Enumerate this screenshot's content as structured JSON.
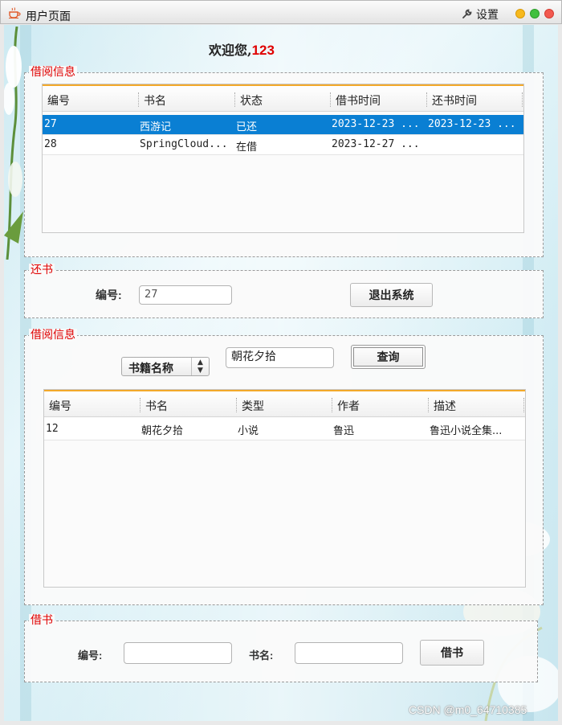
{
  "window": {
    "title": "用户页面",
    "settings_label": "设置"
  },
  "welcome": {
    "text": "欢迎您,",
    "username": "123"
  },
  "borrow_info": {
    "legend": "借阅信息",
    "columns": [
      "编号",
      "书名",
      "状态",
      "借书时间",
      "还书时间"
    ],
    "rows": [
      {
        "id": "27",
        "title": "西游记",
        "status": "已还",
        "borrow_time": "2023-12-23 ...",
        "return_time": "2023-12-23 ...",
        "selected": true
      },
      {
        "id": "28",
        "title": "SpringCloud...",
        "status": "在借",
        "borrow_time": "2023-12-27 ...",
        "return_time": "",
        "selected": false
      }
    ]
  },
  "return_book": {
    "legend": "还书",
    "id_label": "编号:",
    "id_value": "27",
    "exit_button": "退出系统"
  },
  "book_search": {
    "legend": "借阅信息",
    "search_type": "书籍名称",
    "query": "朝花夕拾",
    "search_button": "查询",
    "columns": [
      "编号",
      "书名",
      "类型",
      "作者",
      "描述"
    ],
    "rows": [
      {
        "id": "12",
        "title": "朝花夕拾",
        "type": "小说",
        "author": "鲁迅",
        "desc": "鲁迅小说全集..."
      }
    ]
  },
  "borrow_book": {
    "legend": "借书",
    "id_label": "编号:",
    "id_value": "",
    "title_label": "书名:",
    "title_value": "",
    "borrow_button": "借书"
  },
  "watermark": "CSDN @m0_64710385",
  "colors": {
    "legend": "#e00000",
    "selection": "#0a7fd3",
    "header_accent": "#f3a92b",
    "username": "#e00000"
  }
}
